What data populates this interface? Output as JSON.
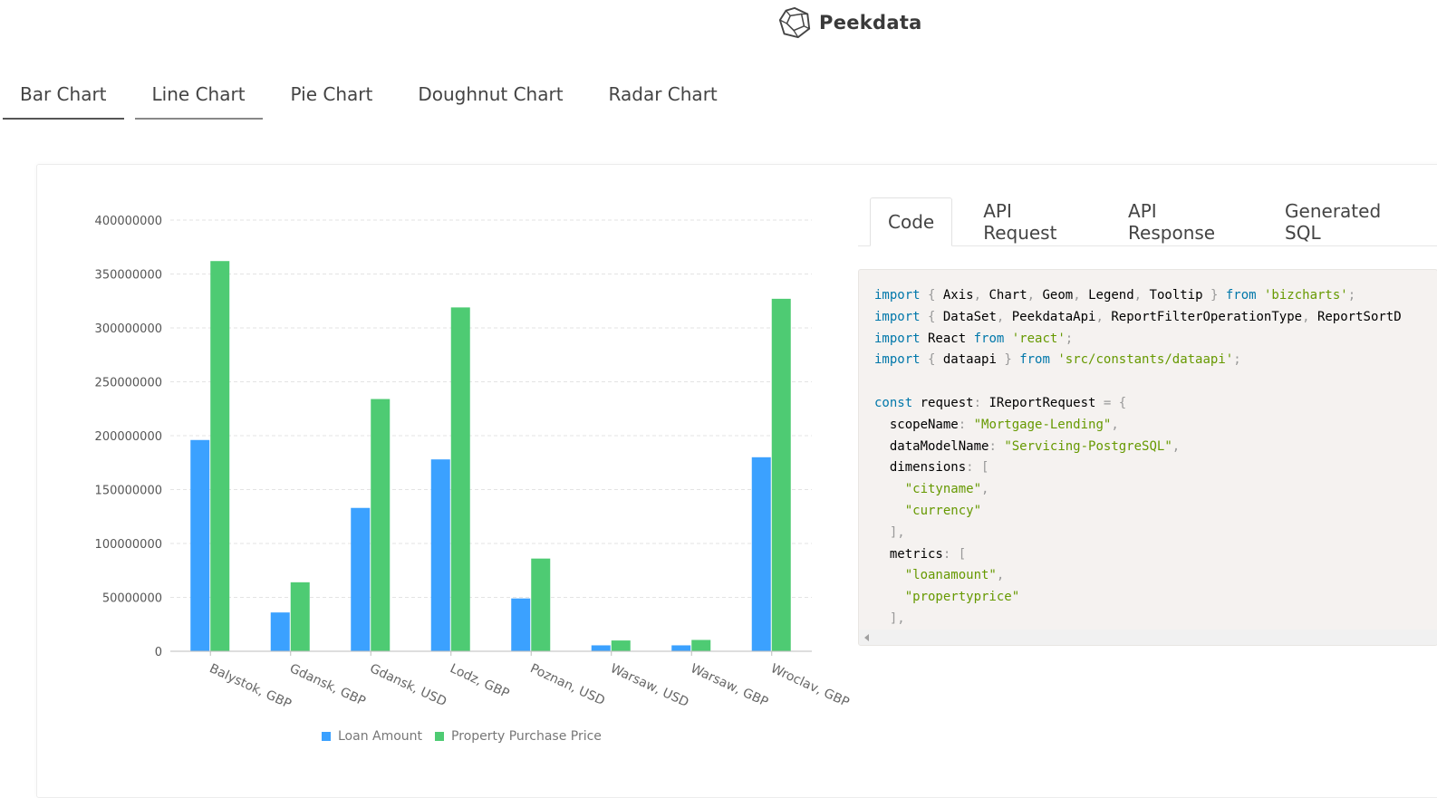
{
  "brand": {
    "name": "Peekdata",
    "logo_icon": "peekdata-logo-icon"
  },
  "chart_tabs": [
    {
      "label": "Bar Chart"
    },
    {
      "label": "Line Chart"
    },
    {
      "label": "Pie Chart"
    },
    {
      "label": "Doughnut Chart"
    },
    {
      "label": "Radar Chart"
    }
  ],
  "code_tabs": [
    {
      "label": "Code"
    },
    {
      "label": "API Request"
    },
    {
      "label": "API Response"
    },
    {
      "label": "Generated SQL"
    }
  ],
  "colors": {
    "loan": "#3ba1ff",
    "property": "#4ecb73",
    "accent": "#555555"
  },
  "legend": [
    {
      "label": "Loan Amount",
      "color": "#3ba1ff"
    },
    {
      "label": "Property Purchase Price",
      "color": "#4ecb73"
    }
  ],
  "code": {
    "lines": [
      "import { Axis, Chart, Geom, Legend, Tooltip } from 'bizcharts';",
      "import { DataSet, PeekdataApi, ReportFilterOperationType, ReportSortD",
      "import React from 'react';",
      "import { dataapi } from 'src/constants/dataapi';",
      "",
      "const request: IReportRequest = {",
      "  scopeName: \"Mortgage-Lending\",",
      "  dataModelName: \"Servicing-PostgreSQL\",",
      "  dimensions: [",
      "    \"cityname\",",
      "    \"currency\"",
      "  ],",
      "  metrics: [",
      "    \"loanamount\",",
      "    \"propertyprice\"",
      "  ],"
    ]
  },
  "chart_data": {
    "type": "bar",
    "categories": [
      "Balystok, GBP",
      "Gdansk, GBP",
      "Gdansk, USD",
      "Lodz, GBP",
      "Poznan, USD",
      "Warsaw, USD",
      "Warsaw, GBP",
      "Wroclav, GBP"
    ],
    "series": [
      {
        "name": "Loan Amount",
        "values": [
          196000000,
          36000000,
          133000000,
          178000000,
          49000000,
          5500000,
          5500000,
          180000000
        ]
      },
      {
        "name": "Property Purchase Price",
        "values": [
          362000000,
          64000000,
          234000000,
          319000000,
          86000000,
          10000000,
          10500000,
          327000000
        ]
      }
    ],
    "y_ticks": [
      "0",
      "50000000",
      "100000000",
      "150000000",
      "200000000",
      "250000000",
      "300000000",
      "350000000",
      "400000000"
    ],
    "ylim": [
      0,
      400000000
    ],
    "grid": true,
    "legend_position": "bottom"
  }
}
